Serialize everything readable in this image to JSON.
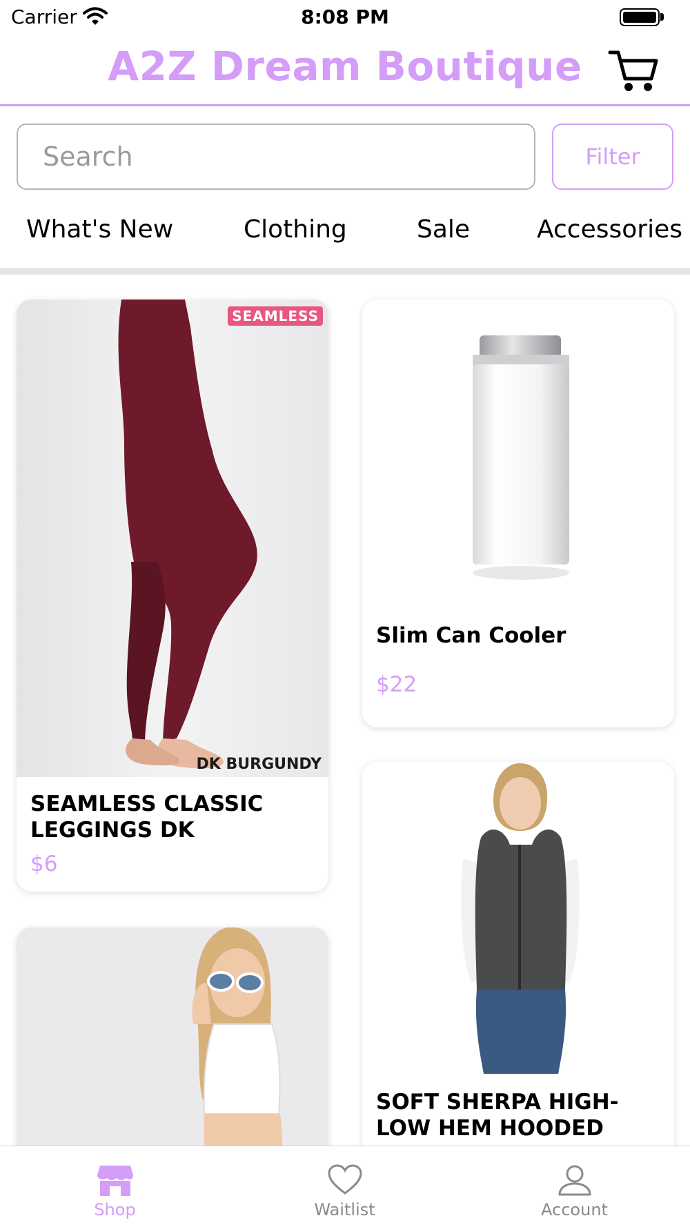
{
  "status_bar": {
    "carrier": "Carrier",
    "time": "8:08 PM"
  },
  "header": {
    "title": "A2Z Dream Boutique"
  },
  "search": {
    "placeholder": "Search",
    "filter_label": "Filter"
  },
  "categories": [
    "What's New",
    "Clothing",
    "Sale",
    "Accessories"
  ],
  "products": [
    {
      "name": "SEAMLESS CLASSIC LEGGINGS  DK",
      "price": "$6",
      "image_badge": "SEAMLESS",
      "image_caption": "DK BURGUNDY"
    },
    {
      "name": "Slim Can Cooler",
      "price": "$22"
    },
    {
      "name": "SOFT SHERPA HIGH-LOW HEM HOODED WITH",
      "price": ""
    },
    {
      "name": "",
      "price": ""
    }
  ],
  "tab_bar": {
    "items": [
      {
        "label": "Shop",
        "icon": "shop-icon",
        "active": true
      },
      {
        "label": "Waitlist",
        "icon": "heart-icon",
        "active": false
      },
      {
        "label": "Account",
        "icon": "person-icon",
        "active": false
      }
    ]
  },
  "colors": {
    "accent": "#d49df8",
    "inactive": "#8a8a8a",
    "text": "#000000"
  }
}
